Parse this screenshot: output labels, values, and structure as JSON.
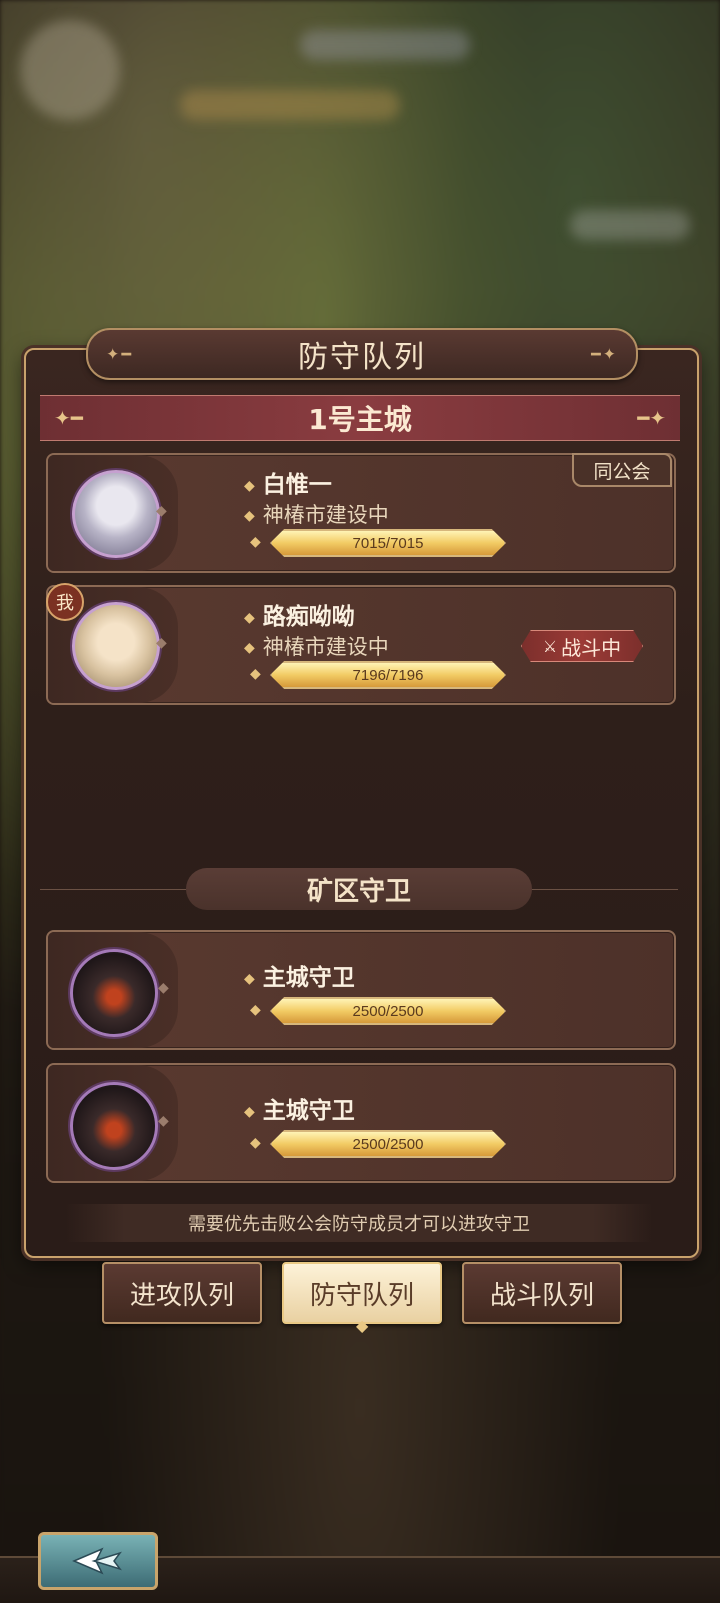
{
  "panel": {
    "title": "防守队列",
    "city_title": "1号主城"
  },
  "defenders": [
    {
      "name": "白惟一",
      "status": "神椿市建设中",
      "hp_text": "7015/7015",
      "hp_fraction": 1.0,
      "tag": "同公会"
    },
    {
      "name": "路痴呦呦",
      "status": "神椿市建设中",
      "hp_text": "7196/7196",
      "hp_fraction": 1.0,
      "me_badge": "我",
      "battle_tag": "战斗中"
    }
  ],
  "guards_section": {
    "title": "矿区守卫",
    "guards": [
      {
        "name": "主城守卫",
        "hp_text": "2500/2500",
        "hp_fraction": 1.0
      },
      {
        "name": "主城守卫",
        "hp_text": "2500/2500",
        "hp_fraction": 1.0
      }
    ]
  },
  "notice": "需要优先击败公会防守成员才可以进攻守卫",
  "tabs": [
    {
      "label": "进攻队列",
      "active": false
    },
    {
      "label": "防守队列",
      "active": true
    },
    {
      "label": "战斗队列",
      "active": false
    }
  ],
  "icons": {
    "back": "back-arrow-icon",
    "swords": "crossed-swords-icon",
    "diamond": "diamond-bullet-icon"
  },
  "colors": {
    "accent_gold": "#d7b77c",
    "banner_red": "#8a3c40",
    "battle_red": "#9c3b36"
  }
}
